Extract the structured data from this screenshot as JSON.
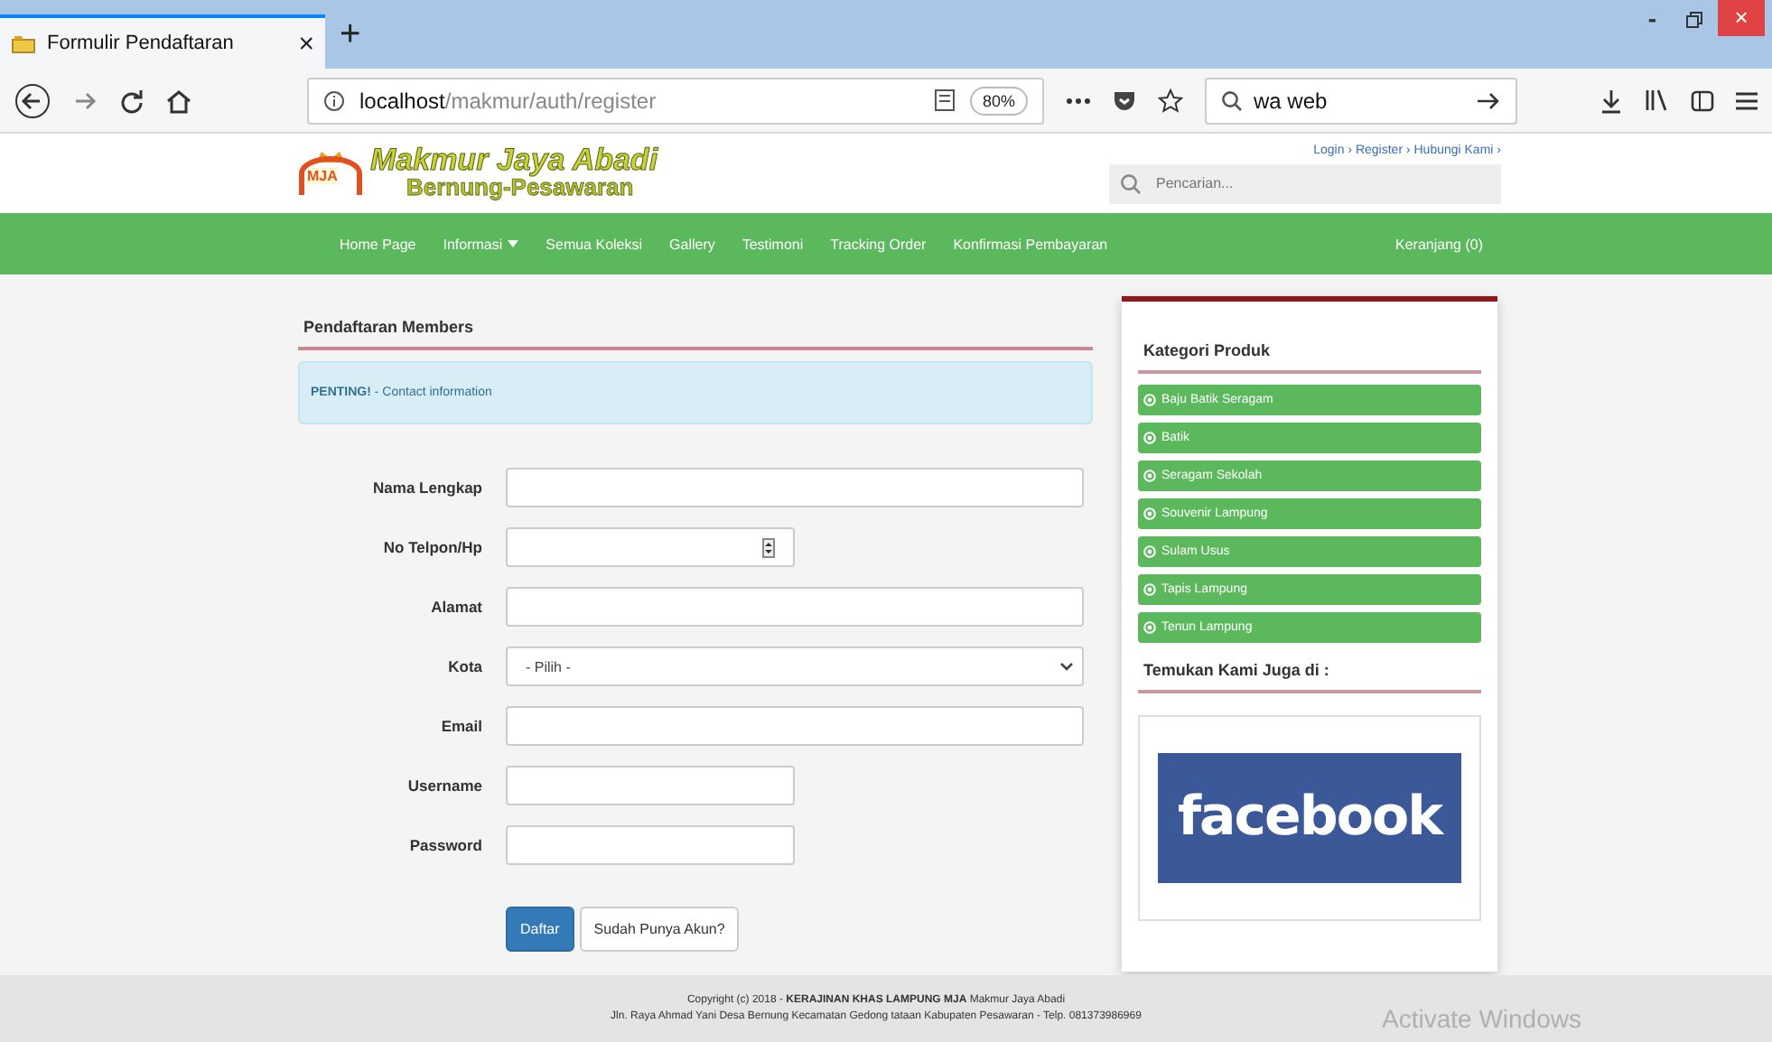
{
  "browser": {
    "tab_title": "Formulir Pendaftaran",
    "new_tab": "+",
    "url_host": "localhost",
    "url_path": "/makmur/auth/register",
    "zoom": "80%",
    "search_value": "wa web",
    "minimize": "-",
    "close": "×"
  },
  "header": {
    "logo_badge": "MJA",
    "brand": "Makmur Jaya Abadi",
    "brand_sub": "Bernung-Pesawaran",
    "top_links": "Login › Register › Hubungi Kami ›",
    "search": {
      "placeholder": "Pencarian..."
    }
  },
  "nav": {
    "items": [
      {
        "label": "Home Page",
        "dropdown": false
      },
      {
        "label": "Informasi",
        "dropdown": true
      },
      {
        "label": "Semua Koleksi",
        "dropdown": false
      },
      {
        "label": "Gallery",
        "dropdown": false
      },
      {
        "label": "Testimoni",
        "dropdown": false
      },
      {
        "label": "Tracking Order",
        "dropdown": false
      },
      {
        "label": "Konfirmasi Pembayaran",
        "dropdown": false
      }
    ],
    "cart": "Keranjang (0)"
  },
  "form": {
    "title": "Pendaftaran Members",
    "alert_strong": "PENTING!",
    "alert_text": " - Contact information",
    "fields": [
      {
        "label": "Nama Lengkap",
        "kind": "text",
        "full_width": true
      },
      {
        "label": "No Telpon/Hp",
        "kind": "number",
        "full_width": false
      },
      {
        "label": "Alamat",
        "kind": "text",
        "full_width": true
      },
      {
        "label": "Kota",
        "kind": "select",
        "full_width": true,
        "value": "- Pilih -"
      },
      {
        "label": "Email",
        "kind": "text",
        "full_width": true
      },
      {
        "label": "Username",
        "kind": "text",
        "full_width": false
      },
      {
        "label": "Password",
        "kind": "password",
        "full_width": false
      }
    ],
    "submit": "Daftar",
    "login_link": "Sudah Punya Akun?"
  },
  "sidebar": {
    "categories_title": "Kategori Produk",
    "categories": [
      "Baju Batik Seragam",
      "Batik",
      "Seragam Sekolah",
      "Souvenir Lampung",
      "Sulam Usus",
      "Tapis Lampung",
      "Tenun Lampung"
    ],
    "social_title": "Temukan Kami Juga di :",
    "facebook": "facebook"
  },
  "footer": {
    "line1": "Copyright (c) 2018 - **KERAJINAN KHAS LAMPUNG MJA** Makmur Jaya Abadi",
    "line2": "Jln. Raya Ahmad Yani Desa Bernung Kecamatan Gedong tataan Kabupaten Pesawaran - Telp. 081373986969"
  },
  "os_notice": "Activate Windows"
}
